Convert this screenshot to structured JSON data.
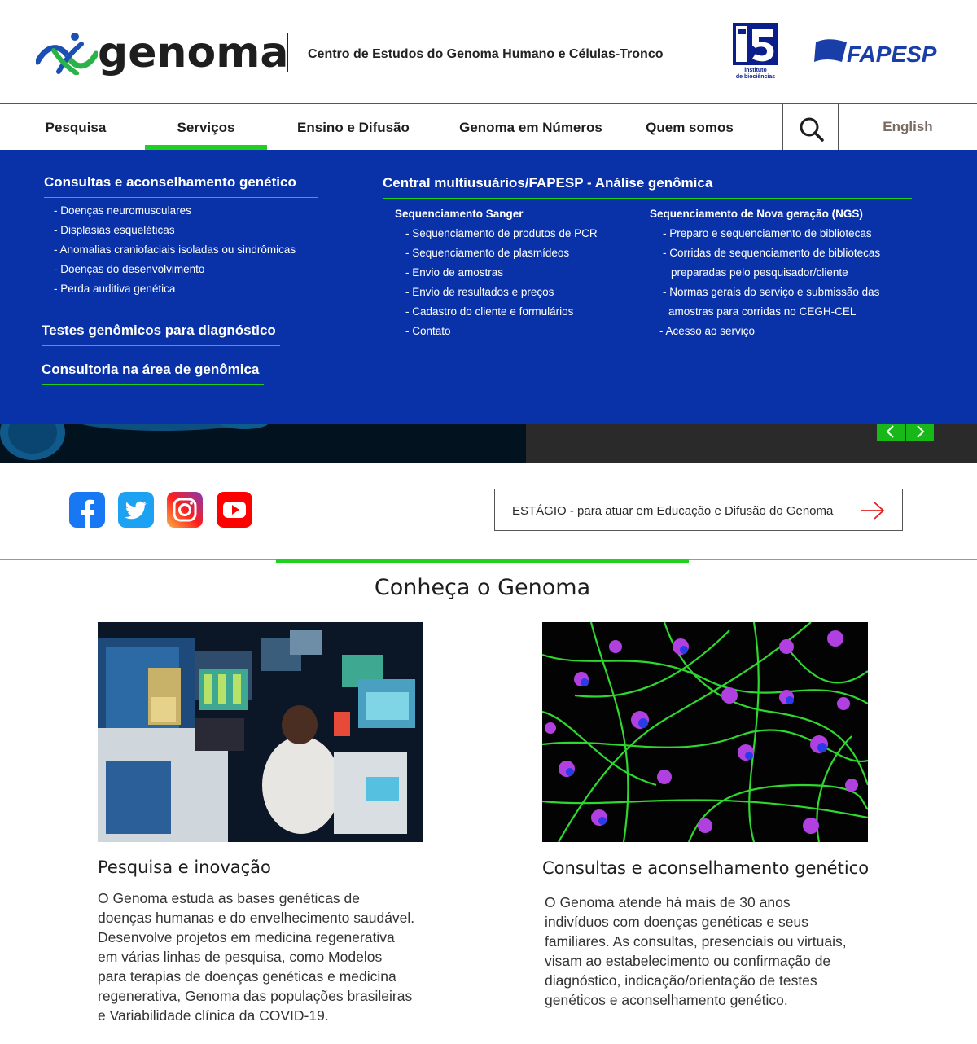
{
  "header": {
    "logo_text": "genoma",
    "tagline": "Centro de Estudos do Genoma Humano e Células-Tronco",
    "ib_logo_text": "instituto de biociências",
    "fapesp_logo_text": "FAPESP"
  },
  "nav": {
    "items": [
      "Pesquisa",
      "Serviços",
      "Ensino e Difusão",
      "Genoma em Números",
      "Quem somos"
    ],
    "active": "Serviços",
    "english": "English"
  },
  "mega": {
    "consultas": {
      "title": "Consultas e aconselhamento genético",
      "items": [
        "- Doenças neuromusculares",
        "- Displasias esqueléticas",
        "- Anomalias craniofaciais isoladas ou sindrômicas",
        "- Doenças do desenvolvimento",
        "- Perda auditiva genética"
      ]
    },
    "testes": "Testes genômicos para diagnóstico",
    "consultoria": "Consultoria na área de genômica",
    "central": {
      "title": "Central multiusuários/FAPESP - Análise genômica",
      "sanger": {
        "title": "Sequenciamento Sanger",
        "items": [
          "- Sequenciamento de produtos de PCR",
          "- Sequenciamento de plasmídeos",
          "- Envio de amostras",
          "- Envio de resultados e preços",
          "- Cadastro do cliente e formulários",
          "- Contato"
        ]
      },
      "ngs": {
        "title": "Sequenciamento de Nova geração (NGS)",
        "items": [
          "- Preparo e sequenciamento de bibliotecas",
          "- Corridas de sequenciamento de bibliotecas",
          "preparadas pelo pesquisador/cliente",
          "- Normas gerais do serviço e submissão das",
          "amostras para corridas no CEGH-CEL",
          "- Acesso ao serviço"
        ]
      }
    }
  },
  "social": [
    "facebook-icon",
    "twitter-icon",
    "instagram-icon",
    "youtube-icon"
  ],
  "estagio": "ESTÁGIO - para atuar em Educação e Difusão do Genoma",
  "section_title": "Conheça o Genoma",
  "cards": [
    {
      "title": "Pesquisa e inovação",
      "lines": [
        "O Genoma estuda as bases genéticas de",
        "doenças humanas e do envelhecimento saudável.",
        "Desenvolve projetos em medicina regenerativa",
        "em várias linhas de pesquisa, como Modelos",
        "para terapias de doenças genéticas e medicina",
        "regenerativa, Genoma das populações brasileiras",
        "e Variabilidade clínica da COVID-19."
      ]
    },
    {
      "title": "Consultas e aconselhamento genético",
      "lines": [
        "O Genoma atende há mais de 30 anos",
        "indivíduos com doenças genéticas e seus",
        "familiares. As consultas, presenciais ou virtuais,",
        "visam ao estabelecimento ou confirmação de",
        "diagnóstico, indicação/orientação de testes",
        "genéticos e aconselhamento genético."
      ]
    }
  ],
  "colors": {
    "accent_green": "#1fd11f",
    "menu_blue": "#0a32a8",
    "logo_blue": "#1a4fb4",
    "logo_green": "#2bb34a"
  }
}
